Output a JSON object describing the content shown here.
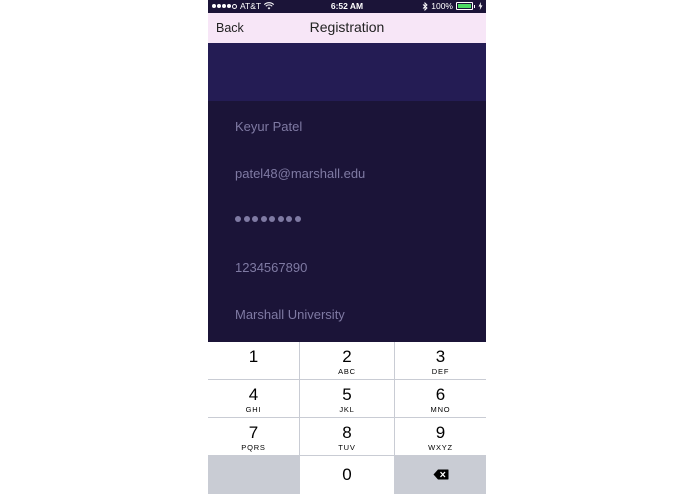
{
  "status": {
    "carrier": "AT&T",
    "time": "6:52 AM",
    "battery": "100%",
    "icons": [
      "signal-dots-icon",
      "wifi-icon",
      "bluetooth-icon",
      "battery-icon",
      "charging-icon"
    ]
  },
  "nav": {
    "back_label": "Back",
    "title": "Registration"
  },
  "form": {
    "name": "Keyur Patel",
    "email": "patel48@marshall.edu",
    "password_mask_count": 8,
    "phone": "1234567890",
    "university": "Marshall University"
  },
  "keypad": {
    "keys": [
      {
        "digit": "1",
        "letters": ""
      },
      {
        "digit": "2",
        "letters": "ABC"
      },
      {
        "digit": "3",
        "letters": "DEF"
      },
      {
        "digit": "4",
        "letters": "GHI"
      },
      {
        "digit": "5",
        "letters": "JKL"
      },
      {
        "digit": "6",
        "letters": "MNO"
      },
      {
        "digit": "7",
        "letters": "PQRS"
      },
      {
        "digit": "8",
        "letters": "TUV"
      },
      {
        "digit": "9",
        "letters": "WXYZ"
      },
      {
        "digit": "0",
        "letters": ""
      }
    ],
    "delete_icon": "backspace-icon"
  },
  "colors": {
    "nav_bg": "#f7e6f7",
    "header_band": "#241c54",
    "form_bg": "#1b1438",
    "field_text": "#7f7aa3",
    "keypad_gray": "#c9ccd4"
  }
}
